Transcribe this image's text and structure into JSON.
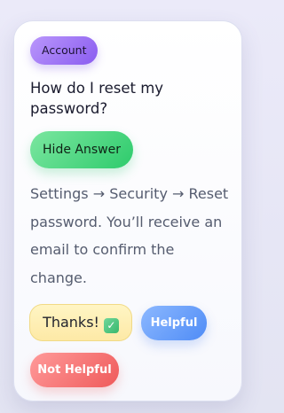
{
  "faq": {
    "category": "Account",
    "question": "How do I reset my password?",
    "toggle_label": "Hide Answer",
    "answer": "Settings → Security → Reset password. You’ll receive an email to confirm the change.",
    "feedback": {
      "thanks_label": "Thanks!",
      "thanks_icon": "✓",
      "helpful_label": "Helpful",
      "not_helpful_label": "Not Helpful"
    }
  },
  "colors": {
    "tag_accent": "#8a5cf0",
    "toggle_accent": "#2ecb6c",
    "thanks_bg": "#fde9a6",
    "helpful_accent": "#4f8cf6",
    "not_helpful_accent": "#ef5a5a"
  }
}
